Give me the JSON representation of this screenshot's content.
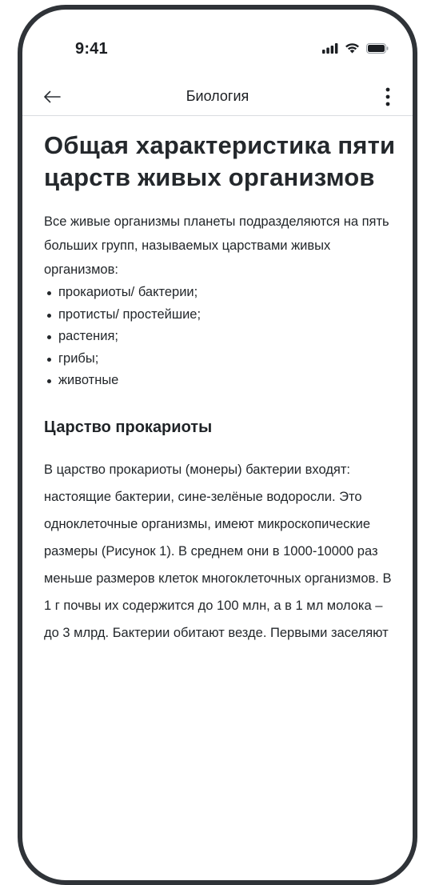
{
  "status_bar": {
    "time": "9:41",
    "icons": [
      "signal-icon",
      "wifi-icon",
      "battery-icon"
    ]
  },
  "app_bar": {
    "title": "Биология",
    "back_icon": "arrow-left-icon",
    "menu_icon": "more-vertical-icon"
  },
  "article": {
    "title": "Общая характеристика пяти царств живых организмов",
    "intro": "Все живые организмы планеты подразделяются на пять больших групп, называемых царствами живых организмов:",
    "kingdoms": [
      "прокариоты/ бактерии;",
      "протисты/ простейшие;",
      "растения;",
      "грибы;",
      "животные"
    ],
    "section_title": "Царство прокариоты",
    "section_body": "В царство прокариоты (монеры) бактерии входят: настоящие бактерии, сине-зелёные водоросли. Это одноклеточные организмы, имеют микроскопические размеры (Рисунок 1). В среднем они в 1000-10000 раз меньше размеров клеток многоклеточных организмов. В 1 г почвы их содержится до 100 млн, а в 1 мл молока – до 3 млрд. Бактерии обитают везде. Первыми заселяют"
  },
  "colors": {
    "text": "#23272b",
    "frame": "#2f3338",
    "divider": "#d9dce0"
  }
}
